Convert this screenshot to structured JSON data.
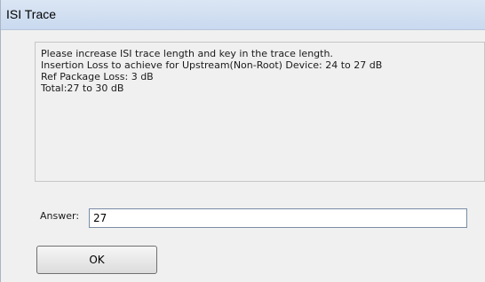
{
  "window": {
    "title": "ISI Trace"
  },
  "message": {
    "lines": [
      "Please increase ISI trace length and key in the trace length.",
      "Insertion Loss to achieve for Upstream(Non-Root) Device: 24 to 27 dB",
      "Ref Package Loss: 3 dB",
      "Total:27 to 30 dB"
    ]
  },
  "answer": {
    "label": "Answer:",
    "value": "27"
  },
  "buttons": {
    "ok_label": "OK"
  }
}
